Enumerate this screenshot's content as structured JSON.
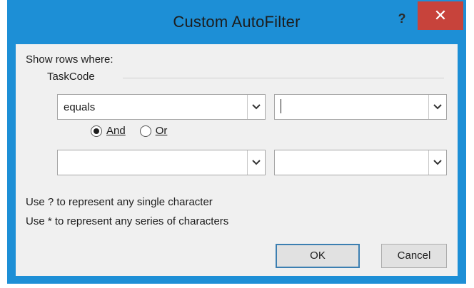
{
  "window": {
    "title": "Custom AutoFilter",
    "help_label": "?",
    "close_label": "✕"
  },
  "dialog": {
    "caption": "Show rows where:",
    "field_name": "TaskCode",
    "condition1": {
      "operator": "equals",
      "value": ""
    },
    "logic": {
      "and_label": "And",
      "or_label": "Or",
      "selected": "And"
    },
    "condition2": {
      "operator": "",
      "value": ""
    },
    "hint1": "Use ? to represent any single character",
    "hint2": "Use * to represent any series of characters",
    "ok_label": "OK",
    "cancel_label": "Cancel"
  },
  "icons": {
    "dropdown": "chevron-down-icon",
    "close": "close-icon",
    "help": "help-icon"
  },
  "colors": {
    "frame": "#1d8fd6",
    "close_button": "#c7433b",
    "body": "#f0f0f0"
  }
}
